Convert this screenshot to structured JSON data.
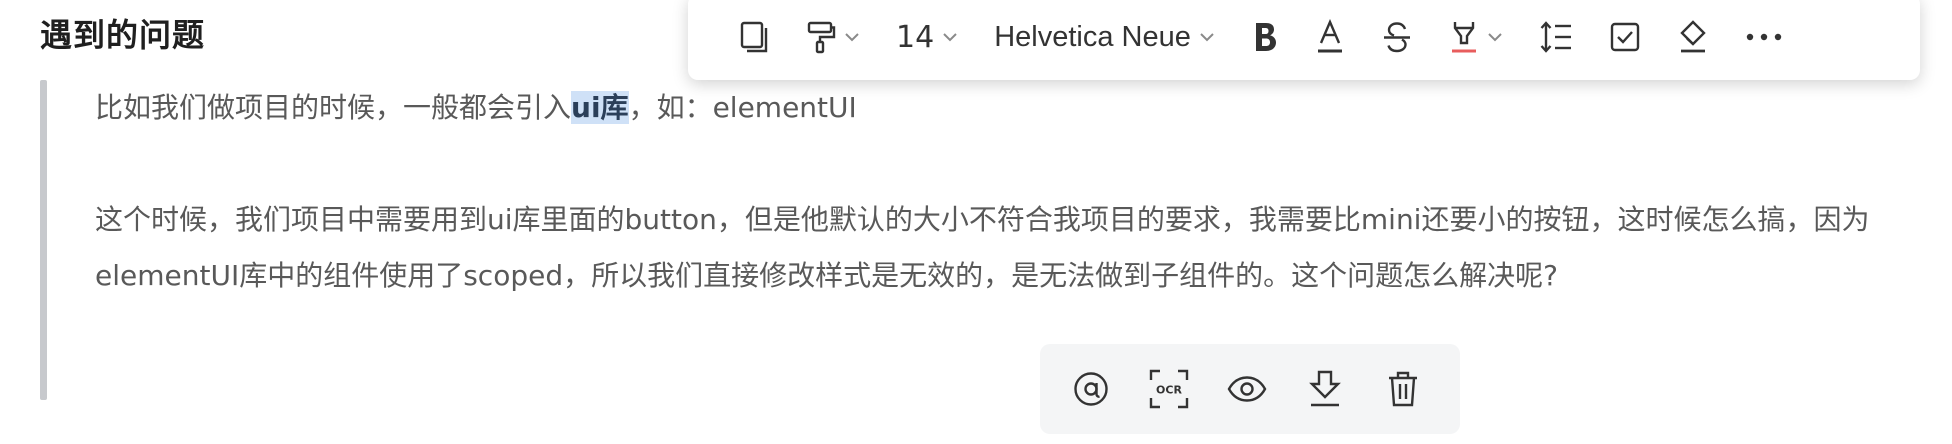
{
  "section": {
    "title": "遇到的问题"
  },
  "quote": {
    "para1_before": "比如我们做项目的时候，一般都会引入",
    "para1_highlight": "ui库",
    "para1_after": "，如：elementUI",
    "para2": "这个时候，我们项目中需要用到ui库里面的button，但是他默认的大小不符合我项目的要求，我需要比mini还要小的按钮，这时候怎么搞，因为elementUI库中的组件使用了scoped，所以我们直接修改样式是无效的，是无法做到子组件的。这个问题怎么解决呢?"
  },
  "format_toolbar": {
    "font_size": "14",
    "font_family": "Helvetica Neue",
    "icons": [
      "copy-icon",
      "format-painter-icon",
      "bold-icon",
      "font-color-icon",
      "strikethrough-icon",
      "highlight-icon",
      "line-height-icon",
      "checkbox-icon",
      "eraser-icon",
      "more-icon"
    ]
  },
  "image_toolbar": {
    "ocr_label": "OCR",
    "icons": [
      "mention-icon",
      "ocr-icon",
      "eye-icon",
      "download-icon",
      "trash-icon"
    ]
  },
  "colors": {
    "highlight_bg": "#cfe1f7",
    "quote_bar": "#c7c9cd",
    "body_text": "#595959",
    "underline_red": "#e85d5d"
  }
}
